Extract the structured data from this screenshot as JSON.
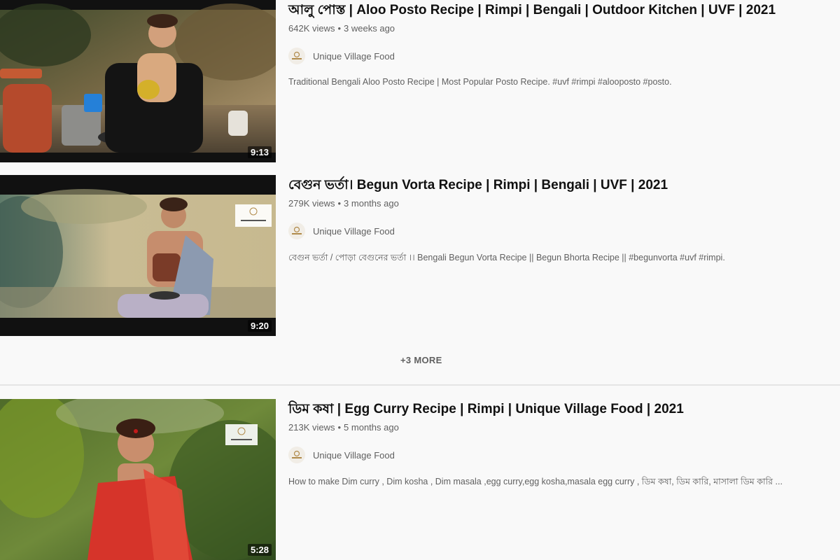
{
  "videos": [
    {
      "title": "আলু পোস্ত | Aloo Posto Recipe | Rimpi | Bengali | Outdoor Kitchen | UVF | 2021",
      "views": "642K views",
      "age": "3 weeks ago",
      "channel": "Unique Village Food",
      "description": "Traditional Bengali Aloo Posto Recipe | Most Popular Posto Recipe. #uvf #rimpi #alooposto #posto.",
      "duration": "9:13"
    },
    {
      "title": "বেগুন ভর্তা। Begun Vorta Recipe | Rimpi | Bengali | UVF | 2021",
      "views": "279K views",
      "age": "3 months ago",
      "channel": "Unique Village Food",
      "description": "বেগুন ভর্তা / পোড়া বেগুনের ভর্তা ।। Bengali Begun Vorta Recipe || Begun Bhorta Recipe || #begunvorta #uvf #rimpi.",
      "duration": "9:20"
    },
    {
      "title": "ডিম কষা | Egg Curry Recipe | Rimpi | Unique Village Food | 2021",
      "views": "213K views",
      "age": "5 months ago",
      "channel": "Unique Village Food",
      "description": "How to make Dim curry , Dim kosha , Dim masala ,egg curry,egg kosha,masala egg curry , ডিম কষা, ডিম কারি, মাসালা ডিম কারি ...",
      "duration": "5:28"
    }
  ],
  "more_label": "+3 MORE",
  "separator": "•",
  "icons": {
    "channel_avatar": "channel-logo-icon"
  },
  "colors": {
    "background": "#f9f9f9",
    "meta_text": "#606060",
    "title_text": "#111111"
  }
}
